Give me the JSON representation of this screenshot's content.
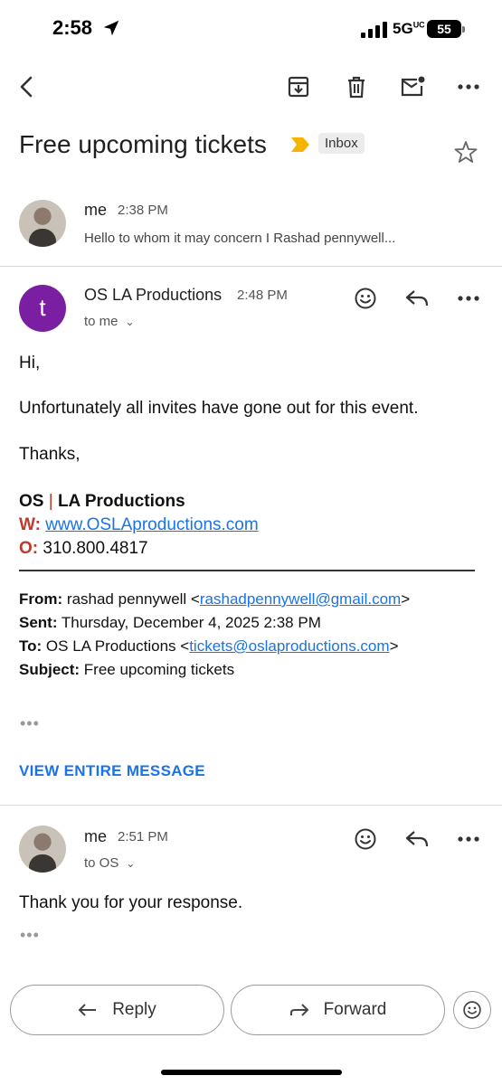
{
  "status": {
    "time": "2:58",
    "network": "5G",
    "network_suffix": "UC",
    "battery": "55"
  },
  "toolbar": {
    "icons": [
      "back-icon",
      "archive-icon",
      "delete-icon",
      "mark-unread-icon",
      "more-icon"
    ]
  },
  "thread": {
    "subject": "Free upcoming tickets",
    "label": "Inbox"
  },
  "messages": [
    {
      "sender": "me",
      "time": "2:38 PM",
      "snippet": "Hello to whom it may concern I Rashad pennywell..."
    },
    {
      "avatar_letter": "t",
      "sender": "OS LA Productions",
      "time": "2:48 PM",
      "recipient": "to me",
      "body": {
        "greeting": "Hi,",
        "line1": "Unfortunately all invites have gone out for this event.",
        "closing": "Thanks,"
      },
      "signature": {
        "name_a": "OS",
        "name_sep": "|",
        "name_b": "LA Productions",
        "web_label": "W:",
        "web": "www.OSLAproductions.com",
        "office_label": "O:",
        "office": "310.800.4817"
      },
      "quoted": {
        "from_label": "From:",
        "from_name": "rashad pennywell <",
        "from_email": "rashadpennywell@gmail.com",
        "from_end": ">",
        "sent_label": "Sent:",
        "sent": "Thursday, December 4, 2025 2:38 PM",
        "to_label": "To:",
        "to_name": "OS LA Productions <",
        "to_email": "tickets@oslaproductions.com",
        "to_end": ">",
        "subject_label": "Subject:",
        "subject": "Free upcoming tickets"
      },
      "ellipsis": "•••",
      "view_entire": "VIEW ENTIRE MESSAGE"
    },
    {
      "sender": "me",
      "time": "2:51 PM",
      "recipient": "to OS",
      "body": "Thank you for your response.",
      "ellipsis": "•••"
    }
  ],
  "actions": {
    "reply": "Reply",
    "forward": "Forward"
  },
  "colors": {
    "avatar": "#7b1fa2",
    "link": "#1a73e8",
    "signature_accent": "#c0392b",
    "important": "#f4b400"
  }
}
